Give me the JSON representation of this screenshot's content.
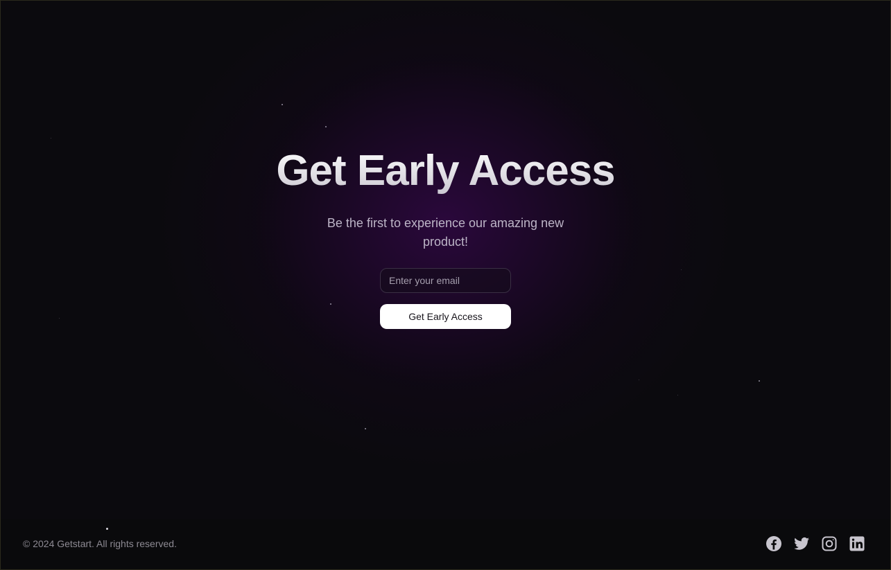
{
  "hero": {
    "title": "Get Early Access",
    "subtitle": "Be the first to experience our amazing new product!"
  },
  "form": {
    "email_value": "",
    "email_placeholder": "Enter your email",
    "submit_label": "Get Early Access"
  },
  "footer": {
    "copyright": "© 2024 Getstart. All rights reserved.",
    "social_icons": [
      "facebook-icon",
      "twitter-icon",
      "instagram-icon",
      "linkedin-icon"
    ]
  },
  "colors": {
    "background": "#0b0a0e",
    "glow": "#2c083e",
    "button_bg": "#ffffff",
    "button_text": "#16131a",
    "muted_text": "#8d8a93"
  }
}
